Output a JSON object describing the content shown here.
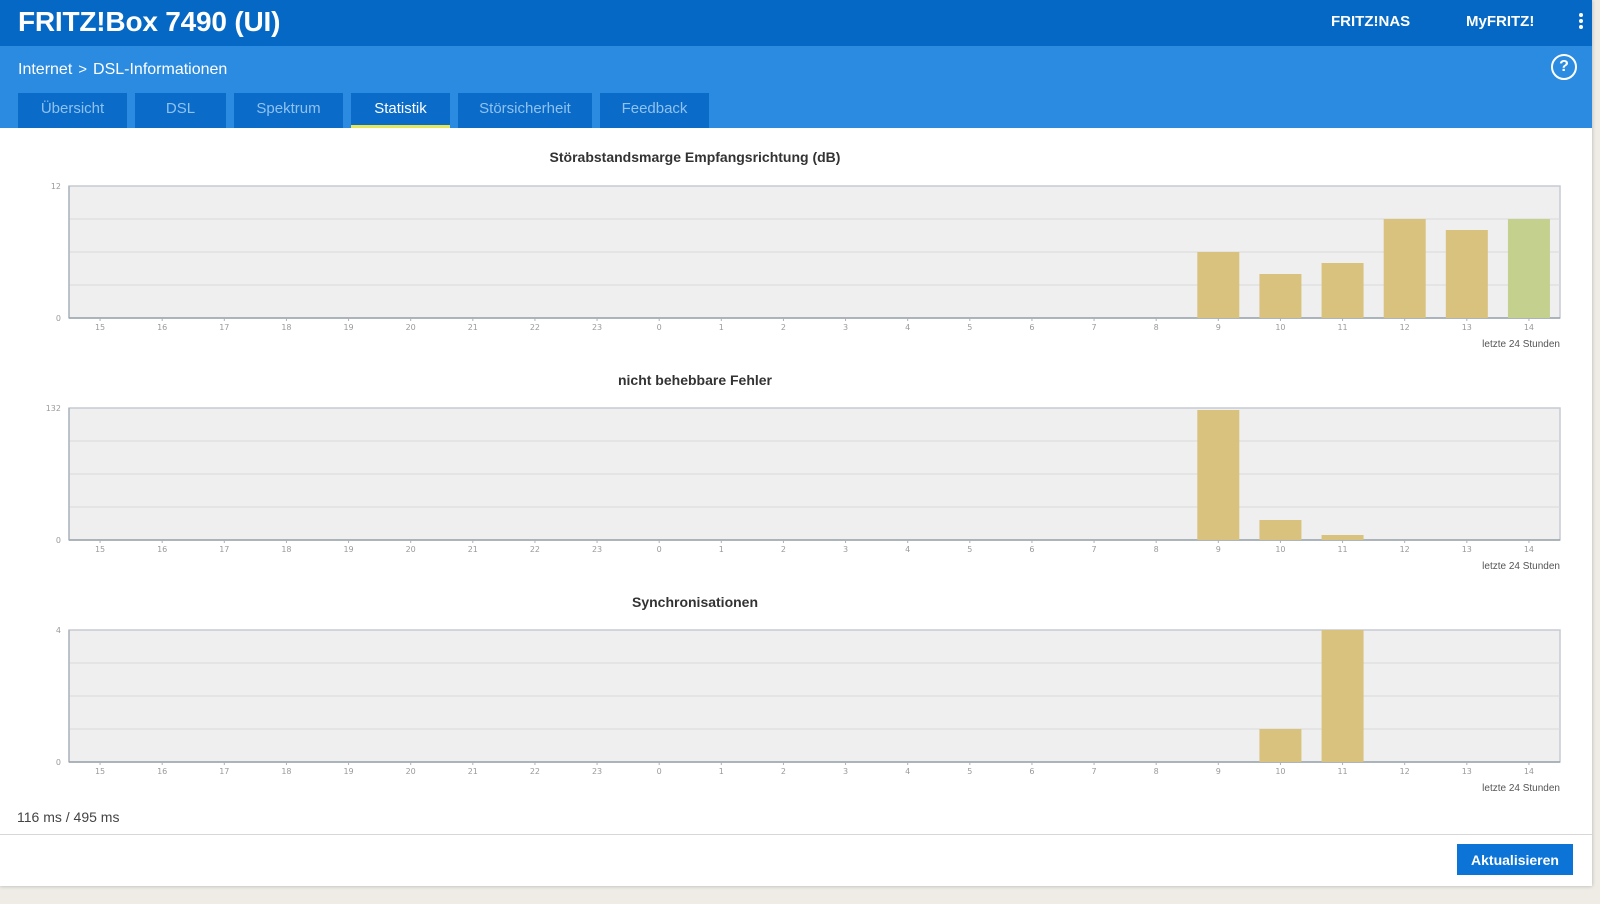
{
  "header": {
    "title": "FRITZ!Box 7490 (UI)",
    "links": [
      "FRITZ!NAS",
      "MyFRITZ!"
    ],
    "menu_icon": "vertical-dots-icon",
    "color": "#0468c4"
  },
  "breadcrumb": {
    "parent": "Internet",
    "separator": ">",
    "current": "DSL-Informationen"
  },
  "help_icon": "help-circle-icon",
  "tabs": [
    {
      "label": "Übersicht",
      "active": false
    },
    {
      "label": "DSL",
      "active": false
    },
    {
      "label": "Spektrum",
      "active": false
    },
    {
      "label": "Statistik",
      "active": true
    },
    {
      "label": "Störsicherheit",
      "active": false
    },
    {
      "label": "Feedback",
      "active": false
    }
  ],
  "chart_data": [
    {
      "type": "bar",
      "title": "Störabstandsmarge Empfangsrichtung (dB)",
      "categories": [
        "15",
        "16",
        "17",
        "18",
        "19",
        "20",
        "21",
        "22",
        "23",
        "0",
        "1",
        "2",
        "3",
        "4",
        "5",
        "6",
        "7",
        "8",
        "9",
        "10",
        "11",
        "12",
        "13",
        "14"
      ],
      "values": [
        null,
        null,
        null,
        null,
        null,
        null,
        null,
        null,
        null,
        null,
        null,
        null,
        null,
        null,
        null,
        null,
        null,
        null,
        6,
        4,
        5,
        9,
        8,
        9
      ],
      "bar_colors": [
        "#d9c27e",
        "#d9c27e",
        "#d9c27e",
        "#d9c27e",
        "#d9c27e",
        "#c4d08e"
      ],
      "ylim": [
        0,
        12
      ],
      "y_tick_labels": [
        "0",
        "12"
      ],
      "note": "letzte 24 Stunden",
      "grid": true
    },
    {
      "type": "bar",
      "title": "nicht behebbare Fehler",
      "categories": [
        "15",
        "16",
        "17",
        "18",
        "19",
        "20",
        "21",
        "22",
        "23",
        "0",
        "1",
        "2",
        "3",
        "4",
        "5",
        "6",
        "7",
        "8",
        "9",
        "10",
        "11",
        "12",
        "13",
        "14"
      ],
      "values": [
        null,
        null,
        null,
        null,
        null,
        null,
        null,
        null,
        null,
        null,
        null,
        null,
        null,
        null,
        null,
        null,
        null,
        null,
        130,
        20,
        5,
        null,
        null,
        null
      ],
      "bar_colors": [
        "#d9c27e",
        "#d9c27e",
        "#d9c27e"
      ],
      "ylim": [
        0,
        132
      ],
      "y_tick_labels": [
        "0",
        "132"
      ],
      "note": "letzte 24 Stunden",
      "grid": true
    },
    {
      "type": "bar",
      "title": "Synchronisationen",
      "categories": [
        "15",
        "16",
        "17",
        "18",
        "19",
        "20",
        "21",
        "22",
        "23",
        "0",
        "1",
        "2",
        "3",
        "4",
        "5",
        "6",
        "7",
        "8",
        "9",
        "10",
        "11",
        "12",
        "13",
        "14"
      ],
      "values": [
        null,
        null,
        null,
        null,
        null,
        null,
        null,
        null,
        null,
        null,
        null,
        null,
        null,
        null,
        null,
        null,
        null,
        null,
        null,
        1,
        4,
        null,
        null,
        null
      ],
      "bar_colors": [
        "#d9c27e",
        "#d9c27e"
      ],
      "ylim": [
        0,
        4
      ],
      "y_tick_labels": [
        "0",
        "4"
      ],
      "note": "letzte 24 Stunden",
      "grid": true
    }
  ],
  "footer": {
    "timing": "116 ms / 495 ms",
    "refresh_label": "Aktualisieren"
  }
}
